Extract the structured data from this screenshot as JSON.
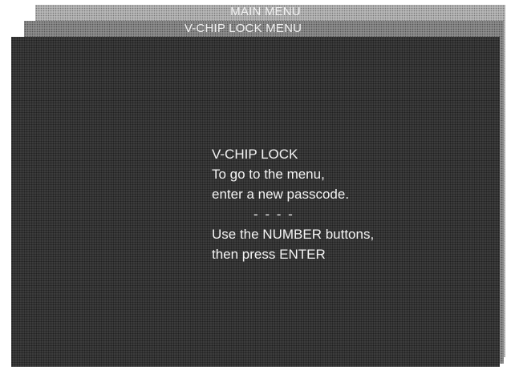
{
  "menu_stack": {
    "main_menu_title": "MAIN MENU",
    "vchip_menu_title": "V-CHIP LOCK MENU"
  },
  "screen": {
    "heading": "V-CHIP LOCK",
    "line1": "To go to the menu,",
    "line2": "enter a new passcode.",
    "passcode_placeholder": "- - - -",
    "line3": "Use the NUMBER buttons,",
    "line4": "then press ENTER"
  }
}
